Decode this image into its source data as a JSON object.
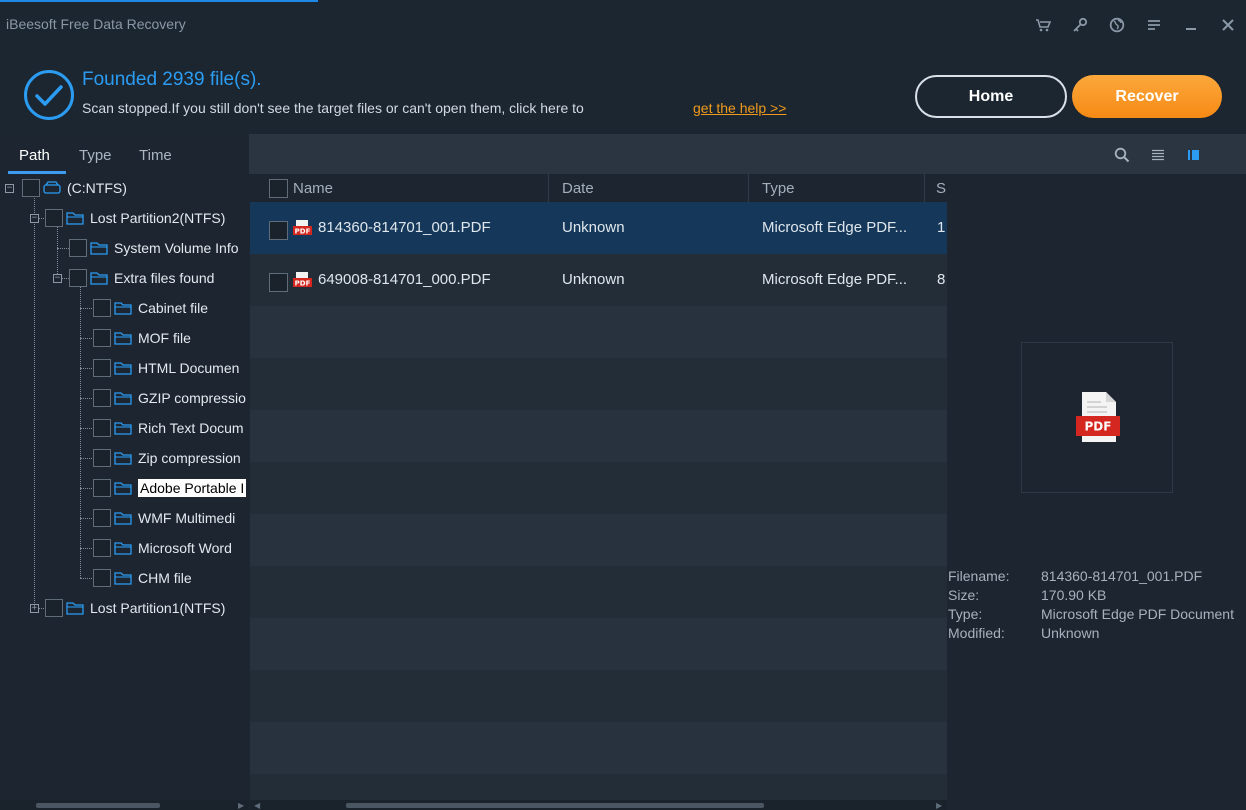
{
  "app": {
    "title": "iBeesoft Free Data Recovery"
  },
  "titlebar_icons": [
    "cart-icon",
    "key-icon",
    "globe-icon",
    "menu-icon",
    "minimize-icon",
    "close-icon"
  ],
  "status": {
    "found": "Founded 2939 file(s).",
    "scan_message": "Scan stopped.If you still don't see the target files or can't open them, click here to",
    "help_link": "get the help >>"
  },
  "buttons": {
    "home": "Home",
    "recover": "Recover"
  },
  "tabs": [
    {
      "label": "Path",
      "active": true
    },
    {
      "label": "Type",
      "active": false
    },
    {
      "label": "Time",
      "active": false
    }
  ],
  "tree": {
    "root": "(C:NTFS)",
    "partition2": "Lost Partition2(NTFS)",
    "system_volume": "System Volume Info",
    "extra_files": "Extra files found",
    "items": [
      "Cabinet file",
      "MOF file",
      "HTML Documen",
      "GZIP compressio",
      "Rich Text Docum",
      "Zip compression",
      "Adobe Portable I",
      "WMF Multimedi",
      "Microsoft Word",
      "CHM file"
    ],
    "selected_item_index": 6,
    "partition1": "Lost Partition1(NTFS)"
  },
  "file_list": {
    "columns": [
      "Name",
      "Date",
      "Type",
      "S"
    ],
    "rows": [
      {
        "name": "814360-814701_001.PDF",
        "date": "Unknown",
        "type": "Microsoft Edge PDF...",
        "size": "1",
        "selected": true
      },
      {
        "name": "649008-814701_000.PDF",
        "date": "Unknown",
        "type": "Microsoft Edge PDF...",
        "size": "8",
        "selected": false
      }
    ]
  },
  "preview": {
    "icon_label": "PDF",
    "filename_label": "Filename:",
    "filename": "814360-814701_001.PDF",
    "size_label": "Size:",
    "size": "170.90 KB",
    "type_label": "Type:",
    "type": "Microsoft Edge PDF Document",
    "modified_label": "Modified:",
    "modified": "Unknown"
  },
  "colors": {
    "accent_blue": "#2b9cf2",
    "recover_orange": "#f68a14",
    "link_orange": "#ef9a1c",
    "background": "#1c2530",
    "selected_row": "#15385a"
  }
}
